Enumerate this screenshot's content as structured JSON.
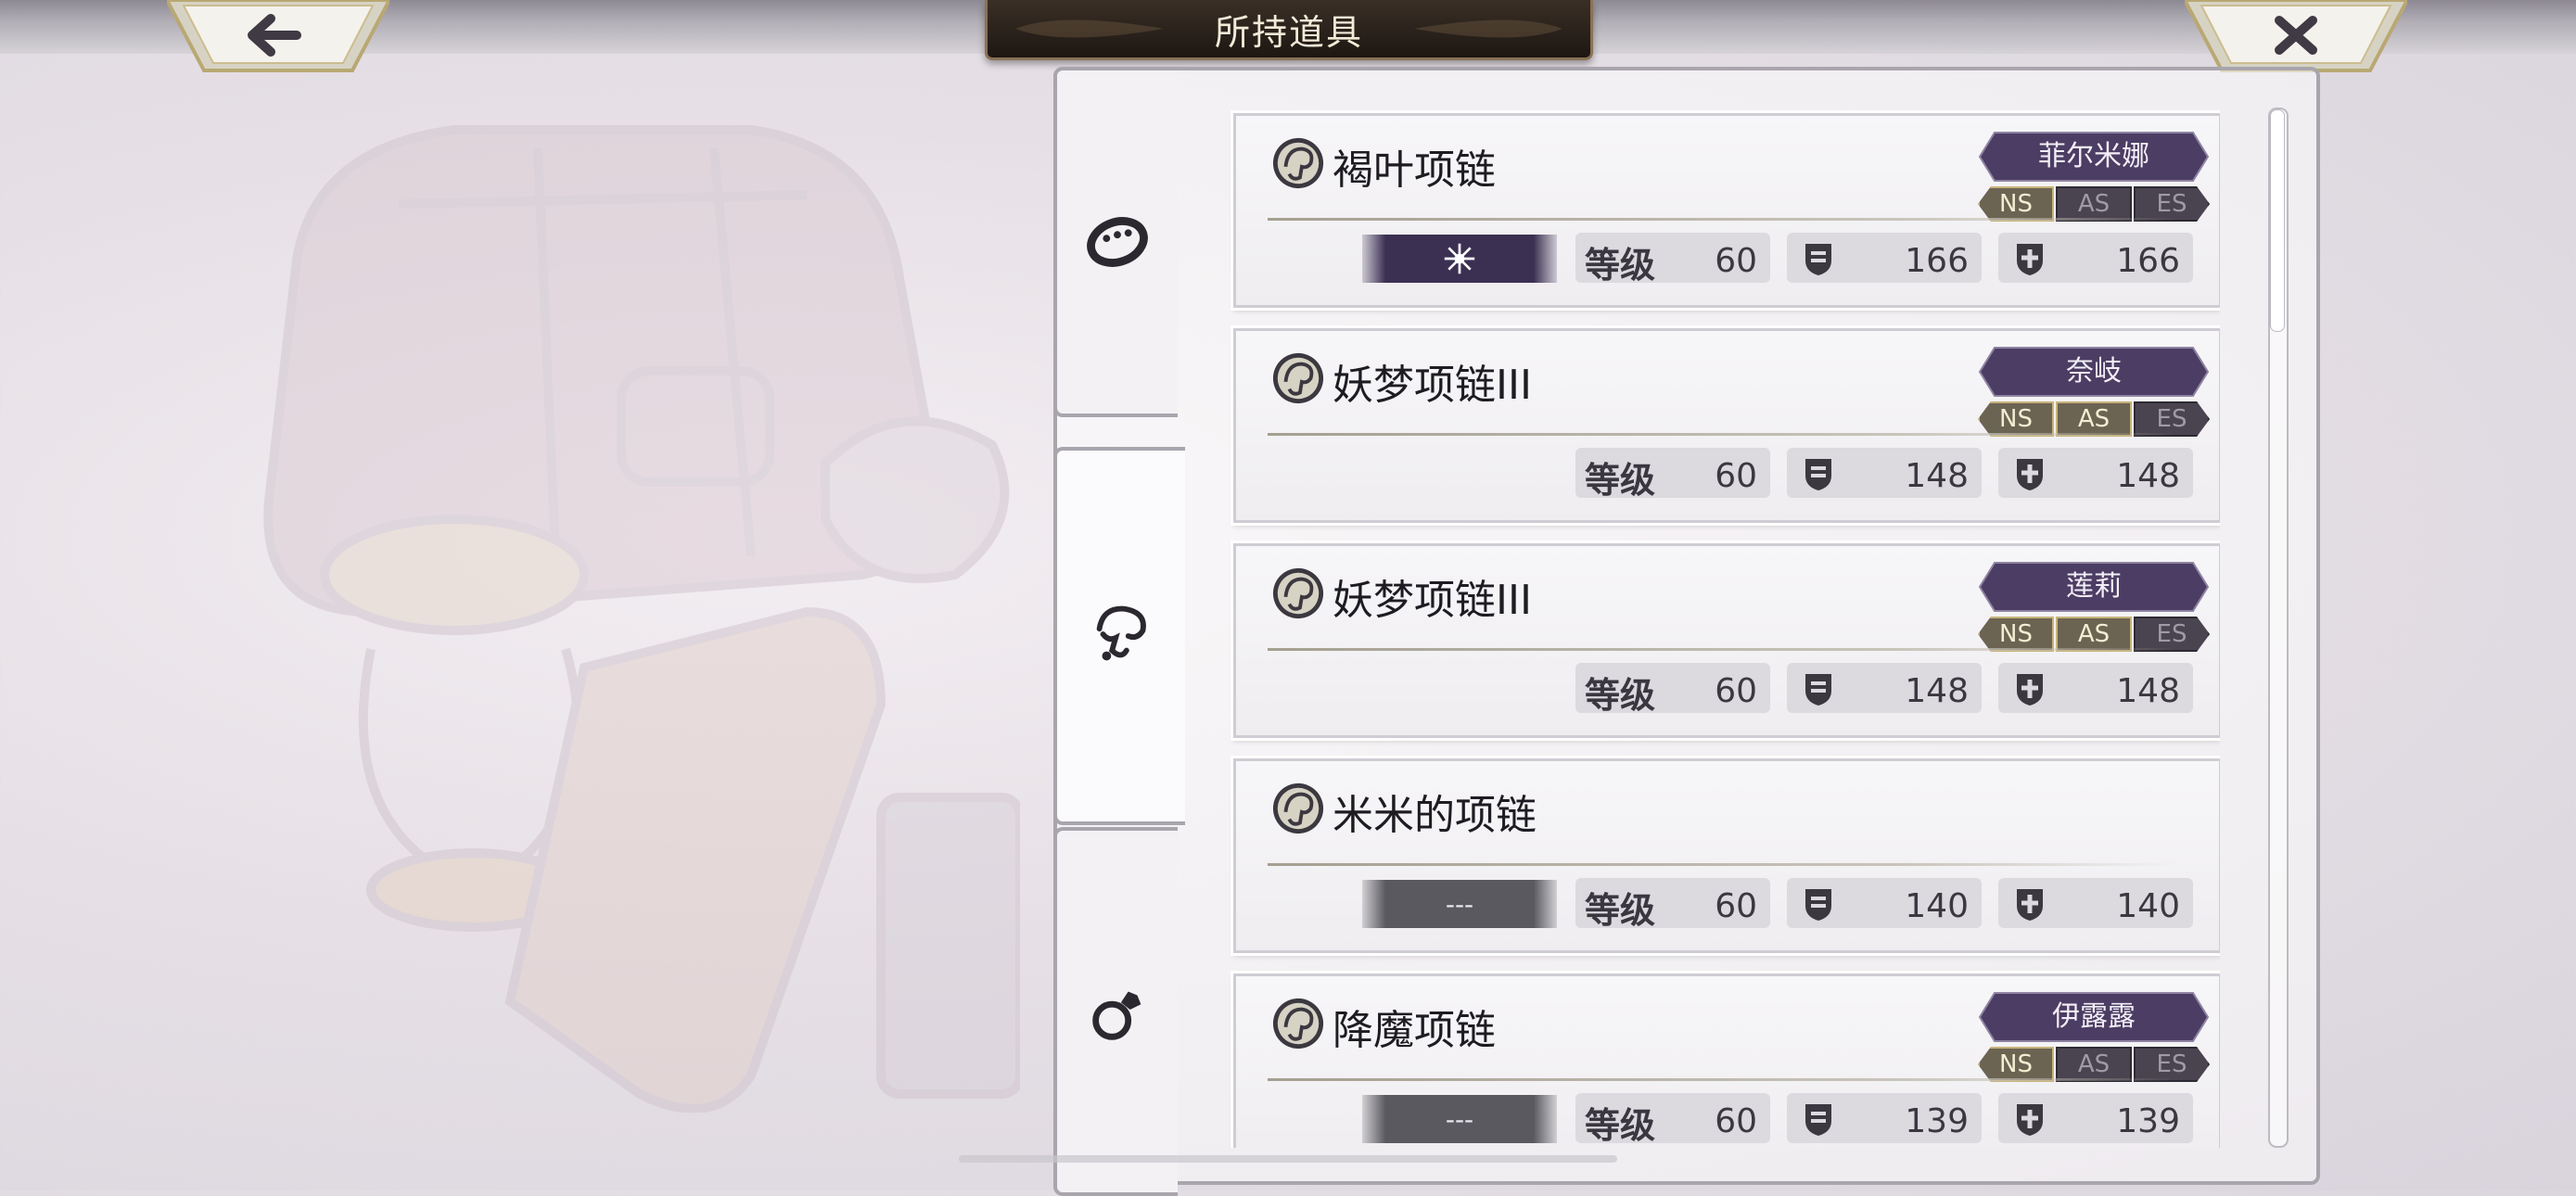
{
  "header": {
    "title": "所持道具",
    "back_icon": "arrow-left-icon",
    "close_icon": "close-icon"
  },
  "tabs": [
    {
      "icon": "bracelet-icon",
      "active": false
    },
    {
      "icon": "necklace-icon",
      "active": true
    },
    {
      "icon": "ring-icon",
      "active": false
    }
  ],
  "labels": {
    "level": "等级",
    "style_ns": "NS",
    "style_as": "AS",
    "style_es": "ES"
  },
  "items": [
    {
      "name": "褐叶项链",
      "character": "菲尔米娜",
      "styles_on": [
        "NS"
      ],
      "enhance": "sparkle-icon",
      "enhance_text": "",
      "level": "60",
      "def": "166",
      "res": "166"
    },
    {
      "name": "妖梦项链III",
      "character": "奈岐",
      "styles_on": [
        "NS",
        "AS"
      ],
      "enhance": "",
      "enhance_text": "",
      "level": "60",
      "def": "148",
      "res": "148"
    },
    {
      "name": "妖梦项链III",
      "character": "莲莉",
      "styles_on": [
        "NS",
        "AS"
      ],
      "enhance": "",
      "enhance_text": "",
      "level": "60",
      "def": "148",
      "res": "148"
    },
    {
      "name": "米米的项链",
      "character": "",
      "styles_on": [],
      "enhance": "none",
      "enhance_text": "---",
      "level": "60",
      "def": "140",
      "res": "140"
    },
    {
      "name": "降魔项链",
      "character": "伊露露",
      "styles_on": [
        "NS"
      ],
      "enhance": "none",
      "enhance_text": "---",
      "level": "60",
      "def": "139",
      "res": "139"
    }
  ],
  "colors": {
    "character_tag": "#4b3d63",
    "enhance_purple": "#3b3052",
    "header_plate": "#2a221b"
  }
}
